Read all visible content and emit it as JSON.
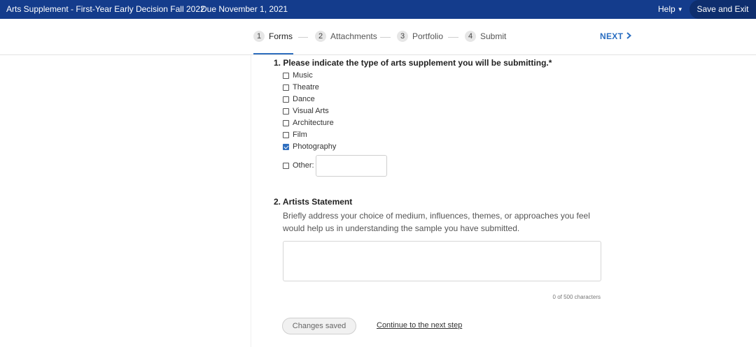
{
  "topbar": {
    "title": "Arts Supplement - First-Year Early Decision Fall 2022",
    "due": "Due November 1, 2021",
    "help_label": "Help",
    "save_exit_label": "Save and Exit",
    "colors": {
      "bar": "#143c8c",
      "save_button": "#0e2e6e"
    }
  },
  "steps": {
    "items": [
      {
        "num": "1",
        "label": "Forms",
        "active": true
      },
      {
        "num": "2",
        "label": "Attachments",
        "active": false
      },
      {
        "num": "3",
        "label": "Portfolio",
        "active": false
      },
      {
        "num": "4",
        "label": "Submit",
        "active": false
      }
    ],
    "next_label": "NEXT",
    "next_icon": "chevron-right-icon",
    "accent": "#2a6ec1"
  },
  "question1": {
    "title": "1. Please indicate the type of arts supplement you will be submitting.*",
    "options": [
      {
        "label": "Music",
        "checked": false
      },
      {
        "label": "Theatre",
        "checked": false
      },
      {
        "label": "Dance",
        "checked": false
      },
      {
        "label": "Visual Arts",
        "checked": false
      },
      {
        "label": "Architecture",
        "checked": false
      },
      {
        "label": "Film",
        "checked": false
      },
      {
        "label": "Photography",
        "checked": true
      }
    ],
    "other_label": "Other:",
    "other_value": ""
  },
  "question2": {
    "title": "2. Artists Statement",
    "description": "Briefly address your choice of medium, influences, themes, or approaches you feel would help us in understanding the sample you have submitted.",
    "value": "",
    "counter": "0 of 500 characters"
  },
  "footer": {
    "saved_label": "Changes saved",
    "continue_label": "Continue to the next step"
  }
}
